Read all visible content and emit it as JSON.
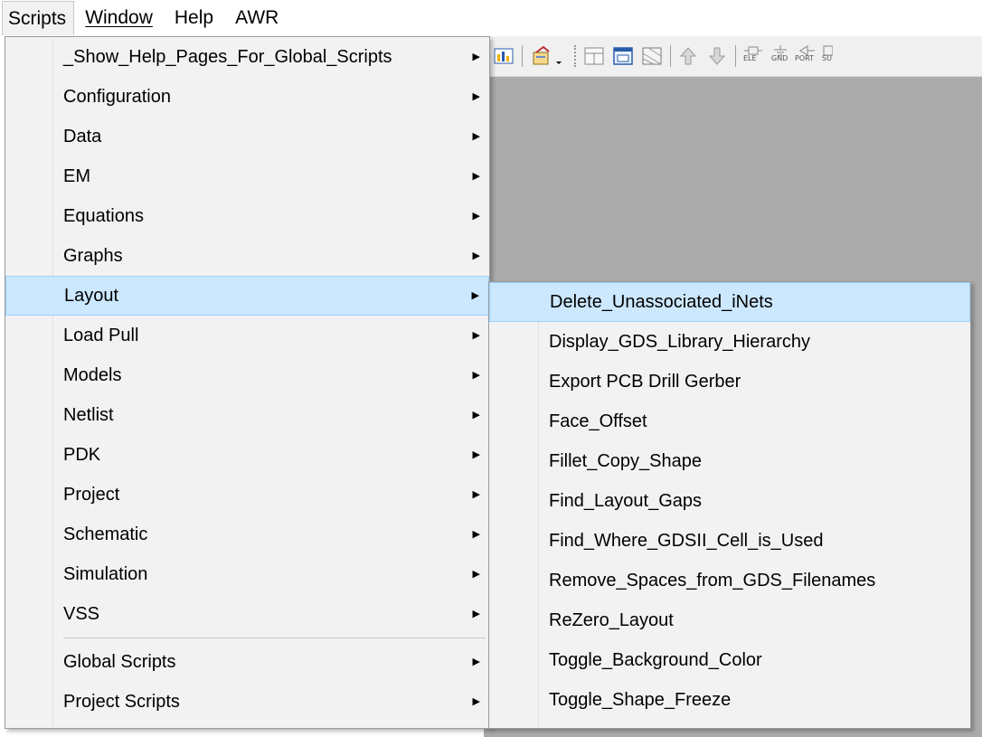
{
  "menubar": {
    "items": [
      {
        "label": "Scripts"
      },
      {
        "label": "Window"
      },
      {
        "label": "Help"
      },
      {
        "label": "AWR"
      }
    ]
  },
  "scripts_menu": {
    "items": [
      {
        "label": "_Show_Help_Pages_For_Global_Scripts",
        "has_submenu": true
      },
      {
        "label": "Configuration",
        "has_submenu": true
      },
      {
        "label": "Data",
        "has_submenu": true
      },
      {
        "label": "EM",
        "has_submenu": true
      },
      {
        "label": "Equations",
        "has_submenu": true
      },
      {
        "label": "Graphs",
        "has_submenu": true
      },
      {
        "label": "Layout",
        "has_submenu": true,
        "selected": true
      },
      {
        "label": "Load Pull",
        "has_submenu": true
      },
      {
        "label": "Models",
        "has_submenu": true
      },
      {
        "label": "Netlist",
        "has_submenu": true
      },
      {
        "label": "PDK",
        "has_submenu": true
      },
      {
        "label": "Project",
        "has_submenu": true
      },
      {
        "label": "Schematic",
        "has_submenu": true
      },
      {
        "label": "Simulation",
        "has_submenu": true
      },
      {
        "label": "VSS",
        "has_submenu": true
      }
    ],
    "footer_items": [
      {
        "label": "Global Scripts",
        "has_submenu": true
      },
      {
        "label": "Project Scripts",
        "has_submenu": true
      }
    ]
  },
  "layout_submenu": {
    "items": [
      {
        "label": "Delete_Unassociated_iNets",
        "selected": true
      },
      {
        "label": "Display_GDS_Library_Hierarchy"
      },
      {
        "label": "Export PCB Drill Gerber"
      },
      {
        "label": "Face_Offset"
      },
      {
        "label": "Fillet_Copy_Shape"
      },
      {
        "label": "Find_Layout_Gaps"
      },
      {
        "label": "Find_Where_GDSII_Cell_is_Used"
      },
      {
        "label": "Remove_Spaces_from_GDS_Filenames"
      },
      {
        "label": "ReZero_Layout"
      },
      {
        "label": "Toggle_Background_Color"
      },
      {
        "label": "Toggle_Shape_Freeze"
      }
    ]
  },
  "toolbar": {
    "labels": {
      "ele": "ELE",
      "gnd": "GND",
      "port": "PORT",
      "sub": "SU"
    }
  },
  "colors": {
    "selection_bg": "#cce8ff",
    "selection_border": "#99d1ff",
    "menu_bg": "#f2f2f2",
    "workspace_bg": "#ababab"
  }
}
